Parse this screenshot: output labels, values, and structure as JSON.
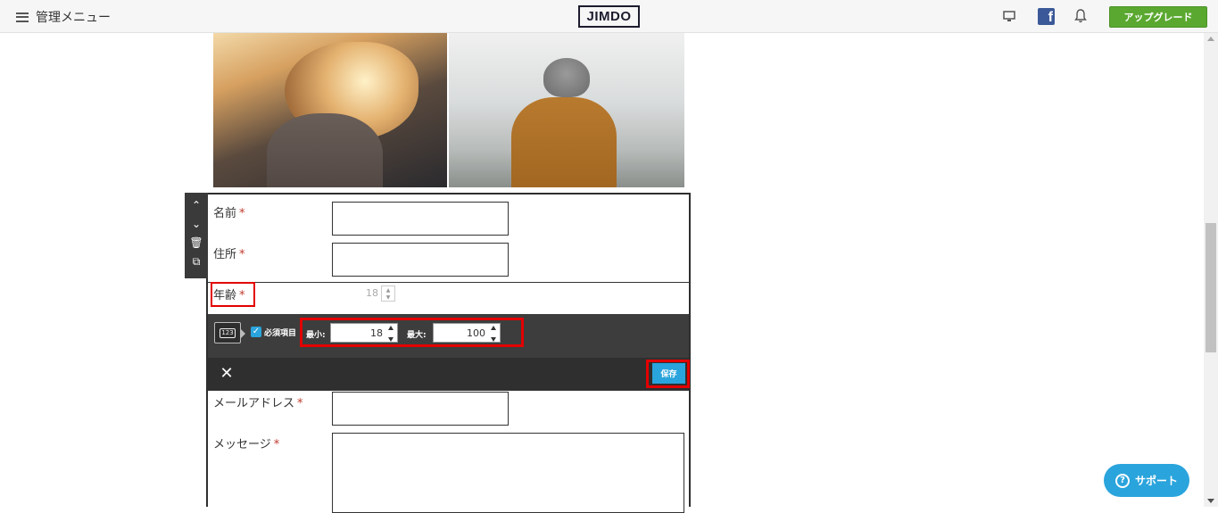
{
  "topbar": {
    "menu_label": "管理メニュー",
    "logo_text": "JIMDO",
    "facebook_glyph": "f",
    "upgrade_label": "アップグレード",
    "icons": [
      "hamburger-icon",
      "monitor-icon",
      "facebook-icon",
      "bell-icon"
    ]
  },
  "colors": {
    "upgrade_green": "#5aa830",
    "accent_blue": "#2aa4dc",
    "highlight_red": "#e30000",
    "required_red": "#c0392b",
    "toolbar_dark": "#3d3d3d"
  },
  "side_tools": {
    "up_glyph": "⌃",
    "down_glyph": "⌄",
    "trash_glyph": "🗑",
    "copy_glyph": "⧉"
  },
  "form": {
    "required_mark": "*",
    "fields": [
      {
        "label": "名前"
      },
      {
        "label": "住所"
      },
      {
        "label": "年齢"
      },
      {
        "label": "メールアドレス"
      },
      {
        "label": "メッセージ"
      }
    ],
    "age_preview_value": "18",
    "settings": {
      "number_icon_text": "123",
      "required_check": "✓",
      "required_label": "必須項目",
      "min_label": "最小:",
      "min_value": "18",
      "max_label": "最大:",
      "max_value": "100"
    },
    "close_glyph": "✕",
    "save_label": "保存"
  },
  "support": {
    "icon_glyph": "?",
    "label": "サポート"
  }
}
